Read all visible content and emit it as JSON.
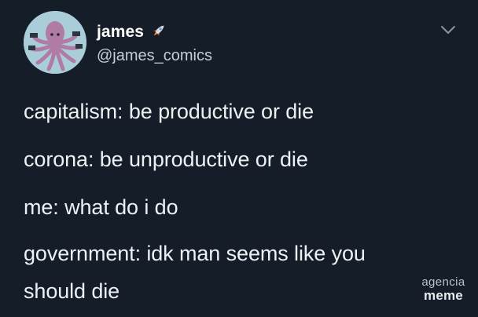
{
  "tweet": {
    "display_name": "james",
    "name_emoji_icon": "rocket-icon",
    "handle": "@james_comics",
    "menu_icon": "chevron-down-icon",
    "lines": [
      "capitalism: be productive or die",
      "corona: be unproductive or die",
      "me: what do i do",
      "government: idk man seems like you",
      "should die"
    ]
  },
  "watermark": {
    "top": "agencia",
    "bottom": "meme"
  },
  "colors": {
    "background": "#151d28",
    "avatar_bg": "#a9ced9",
    "octopus": "#b07ca5",
    "text": "#eef1f4"
  }
}
